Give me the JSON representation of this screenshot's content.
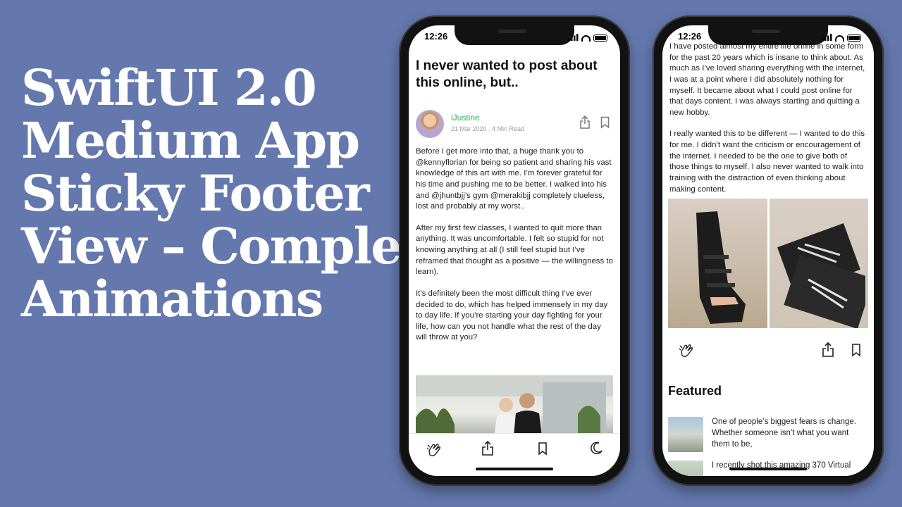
{
  "headline": {
    "lines": [
      "SwiftUI 2.0",
      "Medium App",
      "Sticky Footer",
      "View – Complex",
      "Animations"
    ]
  },
  "phone_left": {
    "status_time": "12:26",
    "article_title": "I never wanted to post about this online, but..",
    "author": {
      "name": "iJustine",
      "meta": "21 Mar 2020 . 4 Min Read"
    },
    "paragraphs": [
      "Before I get more into that, a huge thank you to @kennyflorian for being so patient and sharing his vast knowledge of this art with me. I’m forever grateful for his time and pushing me to be better. I walked into his and @jhuntbjj’s gym @merakibjj completely clueless, lost and probably at my worst..",
      "After my first few classes, I wanted to quit more than anything. It was uncomfortable. I felt so stupid for not knowing anything at all (I still feel stupid but I’ve reframed that thought as a positive — the willingness to learn).",
      "It’s definitely been the most difficult thing I’ve ever decided to do, which has helped immensely in my day to day life. If you’re starting your day fighting for your life, how can you not handle what the rest of the day will throw at you?"
    ],
    "footer_icons": [
      "clap-icon",
      "share-icon",
      "bookmark-icon",
      "moon-icon"
    ]
  },
  "phone_right": {
    "status_time": "12:26",
    "paragraphs": [
      "I have posted almost my entire life online in some form for the past 20 years which is insane to think about. As much as I’ve loved sharing everything with the internet, I was at a point where I did absolutely nothing for myself. It became about what I could post online for that days content. I was always starting and quitting a new hobby.",
      "I really wanted this to be different — I wanted to do this for me. I didn’t want the criticism or encouragement of the internet. I needed to be the one to give both of those things to myself. I also never wanted to walk into training with the distraction of even thinking about making content."
    ],
    "featured_heading": "Featured",
    "featured_items": [
      "One of people’s biggest fears is change. Whether someone isn’t what you want them to be,",
      "I recently shot this amazing 370 Virtual"
    ]
  },
  "colors": {
    "background": "#6478ae",
    "author_green": "#2fb14a",
    "phone_frame": "#121212"
  }
}
